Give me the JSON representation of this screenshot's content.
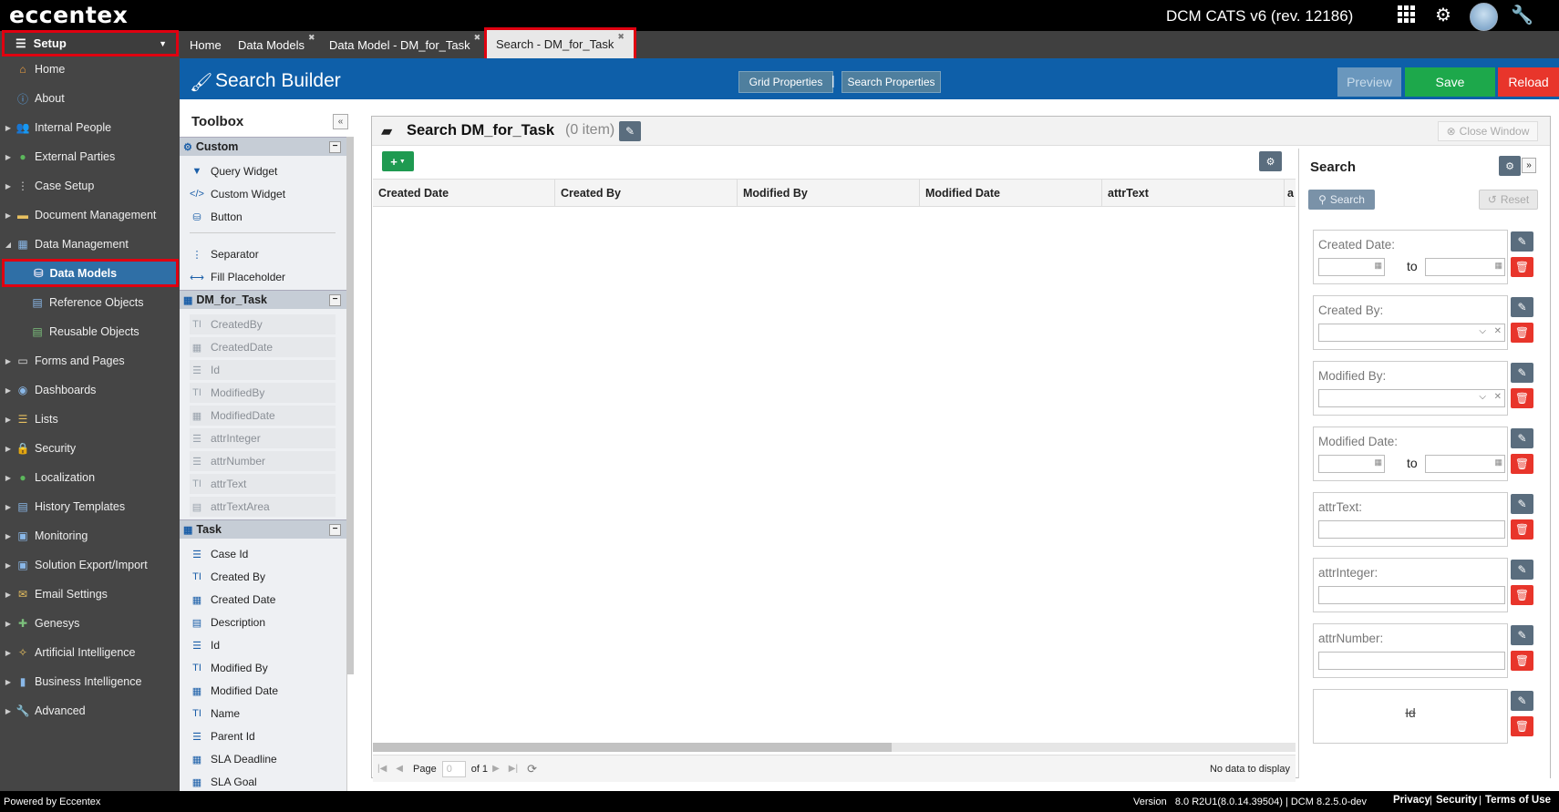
{
  "app": {
    "logo": "eccentex",
    "title": "DCM CATS v6 (rev. 12186)"
  },
  "topbar_icons": [
    "apps-grid-icon",
    "gear-icon",
    "avatar",
    "wrench-icon"
  ],
  "sidebar": {
    "setup_label": "Setup",
    "items": [
      {
        "label": "Home",
        "icon": "home-icon"
      },
      {
        "label": "About",
        "icon": "info-icon"
      },
      {
        "label": "Internal People",
        "icon": "people-icon"
      },
      {
        "label": "External Parties",
        "icon": "globe-icon"
      },
      {
        "label": "Case Setup",
        "icon": "tree-icon"
      },
      {
        "label": "Document Management",
        "icon": "folder-icon"
      },
      {
        "label": "Data Management",
        "icon": "table-icon"
      },
      {
        "label": "Data Models",
        "icon": "database-icon"
      },
      {
        "label": "Reference Objects",
        "icon": "reference-icon"
      },
      {
        "label": "Reusable Objects",
        "icon": "reusable-icon"
      },
      {
        "label": "Forms and Pages",
        "icon": "form-icon"
      },
      {
        "label": "Dashboards",
        "icon": "dashboard-icon"
      },
      {
        "label": "Lists",
        "icon": "list-icon"
      },
      {
        "label": "Security",
        "icon": "lock-icon"
      },
      {
        "label": "Localization",
        "icon": "globe-icon"
      },
      {
        "label": "History Templates",
        "icon": "history-icon"
      },
      {
        "label": "Monitoring",
        "icon": "monitor-icon"
      },
      {
        "label": "Solution Export/Import",
        "icon": "disk-icon"
      },
      {
        "label": "Email Settings",
        "icon": "email-icon"
      },
      {
        "label": "Genesys",
        "icon": "puzzle-icon"
      },
      {
        "label": "Artificial Intelligence",
        "icon": "wand-icon"
      },
      {
        "label": "Business Intelligence",
        "icon": "bar-chart-icon"
      },
      {
        "label": "Advanced",
        "icon": "wrench-icon"
      }
    ]
  },
  "tabs": [
    {
      "label": "Home"
    },
    {
      "label": "Data Models"
    },
    {
      "label": "Data Model - DM_for_Task"
    },
    {
      "label": "Search - DM_for_Task"
    }
  ],
  "builder": {
    "title": "Search Builder",
    "grid_properties": "Grid Properties",
    "search_properties": "Search Properties",
    "preview": "Preview",
    "save": "Save",
    "reload": "Reload"
  },
  "toolbox": {
    "title": "Toolbox",
    "custom_group": "Custom",
    "custom_items": [
      "Query Widget",
      "Custom Widget",
      "Button",
      "Separator",
      "Fill Placeholder"
    ],
    "dm_group": "DM_for_Task",
    "dm_items": [
      "CreatedBy",
      "CreatedDate",
      "Id",
      "ModifiedBy",
      "ModifiedDate",
      "attrInteger",
      "attrNumber",
      "attrText",
      "attrTextArea"
    ],
    "task_group": "Task",
    "task_items": [
      "Case Id",
      "Created By",
      "Created Date",
      "Description",
      "Id",
      "Modified By",
      "Modified Date",
      "Name",
      "Parent Id",
      "SLA Deadline",
      "SLA Goal"
    ]
  },
  "main": {
    "title": "Search DM_for_Task",
    "count": "(0 item)",
    "close_window": "Close Window",
    "add_button": "+",
    "columns": [
      "Created Date",
      "Created By",
      "Modified By",
      "Modified Date",
      "attrText",
      "a"
    ],
    "pager": {
      "page_label": "Page",
      "page_value": "0",
      "of_label": "of 1",
      "no_data": "No data to display"
    }
  },
  "search_panel": {
    "title": "Search",
    "search_btn": "Search",
    "reset_btn": "Reset",
    "fields": [
      {
        "label": "Created Date:",
        "kind": "daterange",
        "to": "to"
      },
      {
        "label": "Created By:",
        "kind": "combo"
      },
      {
        "label": "Modified By:",
        "kind": "combo"
      },
      {
        "label": "Modified Date:",
        "kind": "daterange",
        "to": "to"
      },
      {
        "label": "attrText:",
        "kind": "text"
      },
      {
        "label": "attrInteger:",
        "kind": "text"
      },
      {
        "label": "attrNumber:",
        "kind": "text"
      },
      {
        "label": "Id",
        "kind": "hidden"
      }
    ]
  },
  "footer": {
    "powered": "Powered by Eccentex",
    "version": "Version   8.0 R2U1(8.0.14.39504) | DCM 8.2.5.0-dev",
    "links": [
      "Privacy",
      "Security",
      "Terms of Use"
    ]
  }
}
